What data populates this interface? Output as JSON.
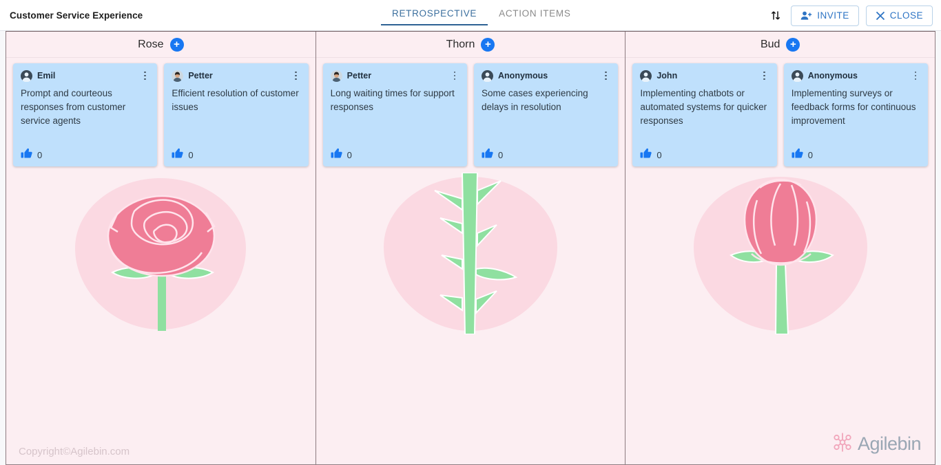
{
  "header": {
    "board_title": "Customer Service Experience",
    "tabs": [
      {
        "label": "RETROSPECTIVE",
        "active": true
      },
      {
        "label": "ACTION ITEMS",
        "active": false
      }
    ],
    "sort_icon": "sort-arrows-icon",
    "invite_label": "INVITE",
    "close_label": "CLOSE",
    "accent_color": "#2d6193"
  },
  "board": {
    "watermark": "Agilebin.com",
    "copyright": "Copyright©Agilebin.com",
    "brand_name": "Agilebin",
    "add_symbol": "+",
    "card_color": "#bfe0fc",
    "column_color": "#fceef2",
    "columns": [
      {
        "title": "Rose",
        "art": "rose-flower-art",
        "cards": [
          {
            "author": "Emil",
            "avatar": "person-avatar-icon",
            "text": "Prompt and courteous responses from customer service agents",
            "likes": "0"
          },
          {
            "author": "Petter",
            "avatar": "person-photo-avatar",
            "text": "Efficient resolution of customer issues",
            "likes": "0"
          }
        ]
      },
      {
        "title": "Thorn",
        "art": "thorn-stem-art",
        "cards": [
          {
            "author": "Petter",
            "avatar": "person-photo-avatar",
            "text": "Long waiting times for support responses",
            "likes": "0"
          },
          {
            "author": "Anonymous",
            "avatar": "person-avatar-icon",
            "text": "Some cases experiencing delays in resolution",
            "likes": "0"
          }
        ]
      },
      {
        "title": "Bud",
        "art": "rose-bud-art",
        "cards": [
          {
            "author": "John",
            "avatar": "person-avatar-icon",
            "text": "Implementing chatbots or automated systems for quicker responses",
            "likes": "0"
          },
          {
            "author": "Anonymous",
            "avatar": "person-avatar-icon",
            "text": "Implementing surveys or feedback forms for continuous improvement",
            "likes": "0"
          }
        ]
      }
    ]
  }
}
